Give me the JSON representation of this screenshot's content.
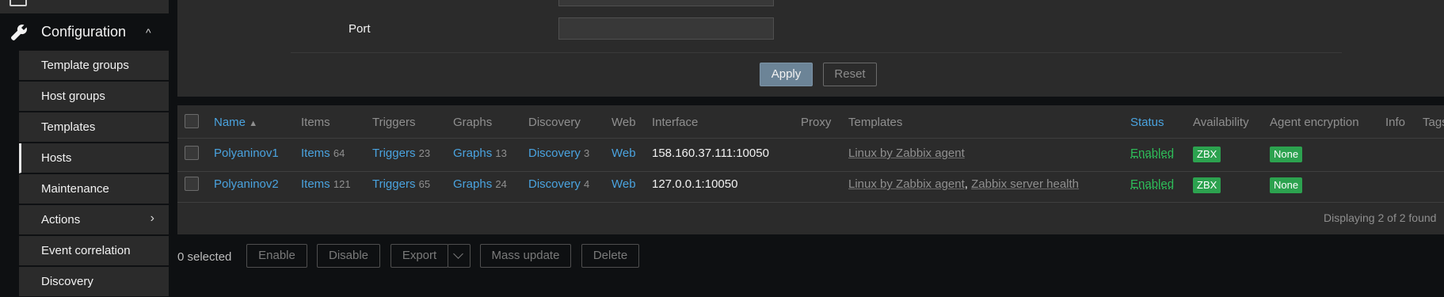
{
  "sidebar": {
    "section": {
      "label": "Configuration",
      "icon": "wrench-icon"
    },
    "items": [
      {
        "label": "Template groups"
      },
      {
        "label": "Host groups"
      },
      {
        "label": "Templates"
      },
      {
        "label": "Hosts",
        "active": true
      },
      {
        "label": "Maintenance"
      },
      {
        "label": "Actions",
        "has_submenu": true
      },
      {
        "label": "Event correlation"
      },
      {
        "label": "Discovery"
      }
    ]
  },
  "filter": {
    "port_label": "Port",
    "port_value": "",
    "apply_label": "Apply",
    "reset_label": "Reset"
  },
  "table": {
    "columns": [
      "Name",
      "Items",
      "Triggers",
      "Graphs",
      "Discovery",
      "Web",
      "Interface",
      "Proxy",
      "Templates",
      "Status",
      "Availability",
      "Agent encryption",
      "Info",
      "Tags"
    ],
    "sort_indicator": "▲",
    "rows": [
      {
        "name": "Polyaninov1",
        "items_label": "Items",
        "items_count": "64",
        "triggers_label": "Triggers",
        "triggers_count": "23",
        "graphs_label": "Graphs",
        "graphs_count": "13",
        "discovery_label": "Discovery",
        "discovery_count": "3",
        "web": "Web",
        "interface": "158.160.37.111:10050",
        "proxy": "",
        "templates": [
          "Linux by Zabbix agent"
        ],
        "status": "Enabled",
        "availability": "ZBX",
        "encryption": "None"
      },
      {
        "name": "Polyaninov2",
        "items_label": "Items",
        "items_count": "121",
        "triggers_label": "Triggers",
        "triggers_count": "65",
        "graphs_label": "Graphs",
        "graphs_count": "24",
        "discovery_label": "Discovery",
        "discovery_count": "4",
        "web": "Web",
        "interface": "127.0.0.1:10050",
        "proxy": "",
        "templates": [
          "Linux by Zabbix agent",
          "Zabbix server health"
        ],
        "template_separator": ",",
        "status": "Enabled",
        "availability": "ZBX",
        "encryption": "None"
      }
    ],
    "footer": "Displaying 2 of 2 found"
  },
  "actions": {
    "selected": "0 selected",
    "buttons": [
      "Enable",
      "Disable",
      "Export",
      "Mass update",
      "Delete"
    ]
  },
  "colors": {
    "link": "#4aa3df",
    "enabled": "#2ebd59",
    "badge": "#2ca24f",
    "panel": "#2b2b2b",
    "background": "#0e1012"
  }
}
